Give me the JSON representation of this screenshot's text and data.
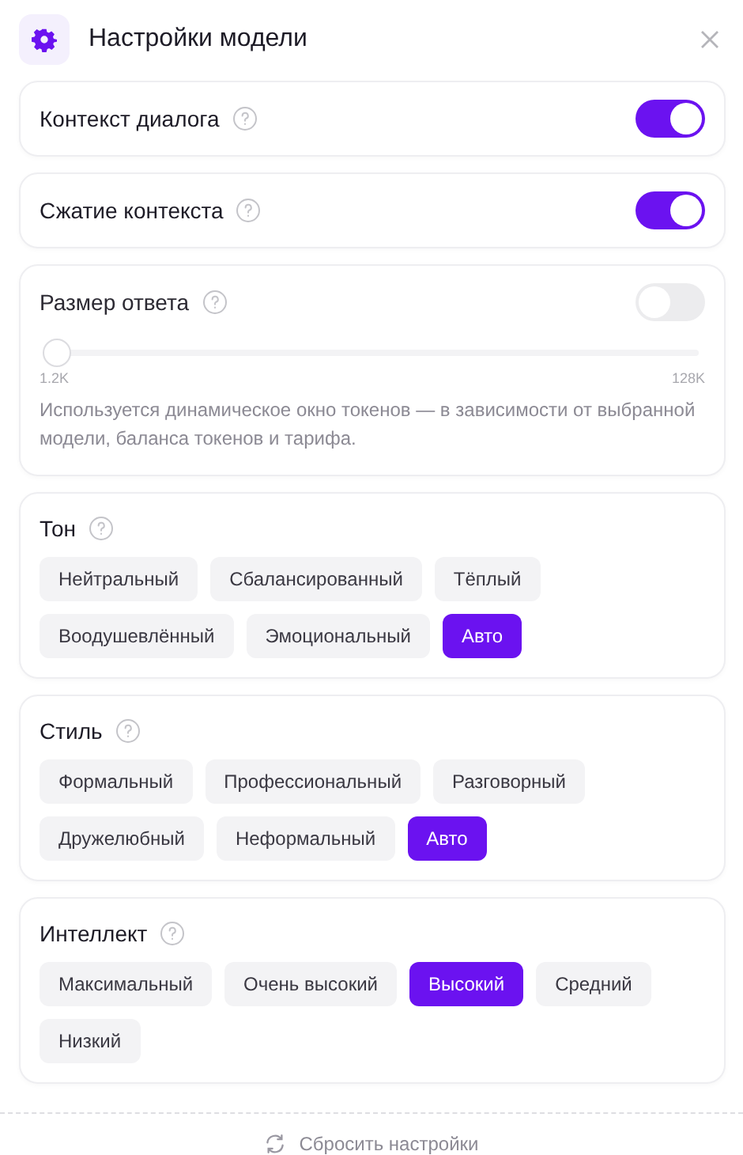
{
  "header": {
    "title": "Настройки модели"
  },
  "toggles": [
    {
      "label": "Контекст диалога",
      "on": true
    },
    {
      "label": "Сжатие контекста",
      "on": true
    }
  ],
  "response_size": {
    "label": "Размер ответа",
    "on": false,
    "disabled": true,
    "level": 0,
    "min_label": "1.2K",
    "max_label": "128K",
    "description": "Используется динамическое окно токенов — в зависимости от выбранной модели, баланса токенов и тарифа."
  },
  "groups": [
    {
      "title": "Тон",
      "options": [
        {
          "label": "Нейтральный",
          "selected": false
        },
        {
          "label": "Сбалансированный",
          "selected": false
        },
        {
          "label": "Тёплый",
          "selected": false
        },
        {
          "label": "Воодушевлённый",
          "selected": false
        },
        {
          "label": "Эмоциональный",
          "selected": false
        },
        {
          "label": "Авто",
          "selected": true
        }
      ]
    },
    {
      "title": "Стиль",
      "options": [
        {
          "label": "Формальный",
          "selected": false
        },
        {
          "label": "Профессиональный",
          "selected": false
        },
        {
          "label": "Разговорный",
          "selected": false
        },
        {
          "label": "Дружелюбный",
          "selected": false
        },
        {
          "label": "Неформальный",
          "selected": false
        },
        {
          "label": "Авто",
          "selected": true
        }
      ]
    },
    {
      "title": "Интеллект",
      "options": [
        {
          "label": "Максимальный",
          "selected": false
        },
        {
          "label": "Очень высокий",
          "selected": false
        },
        {
          "label": "Высокий",
          "selected": true
        },
        {
          "label": "Средний",
          "selected": false
        },
        {
          "label": "Низкий",
          "selected": false
        }
      ]
    }
  ],
  "footer": {
    "reset_label": "Сбросить настройки"
  }
}
